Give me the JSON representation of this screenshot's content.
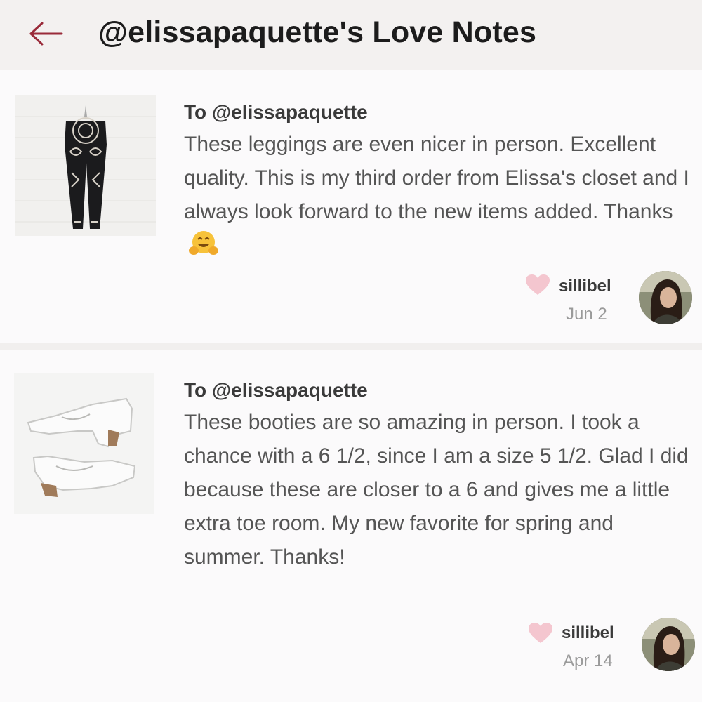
{
  "header": {
    "title": "@elissapaquette's Love Notes",
    "back_icon": "arrow-left-icon",
    "accent": "#9a2b3a"
  },
  "notes": [
    {
      "to": "To @elissapaquette",
      "text": "These leggings are even nicer in person. Excellent quality. This is my third order from Elissa's closet and I always look forward to the new items added. Thanks",
      "emoji": "hugging-face-emoji",
      "thumbnail_icon": "leggings-photo",
      "user": "sillibel",
      "date": "Jun 2"
    },
    {
      "to": "To @elissapaquette",
      "text": "These booties are so amazing in person. I took a chance with a 6 1/2, since I am a size 5 1/2. Glad I did because these are closer to a 6 and gives me a little extra toe room. My new favorite for spring and summer. Thanks!",
      "thumbnail_icon": "booties-photo",
      "user": "sillibel",
      "date": "Apr 14"
    }
  ],
  "colors": {
    "heart": "#f4c6cf",
    "header_bg": "#f3f1f0",
    "page_bg": "#fbfafb"
  }
}
